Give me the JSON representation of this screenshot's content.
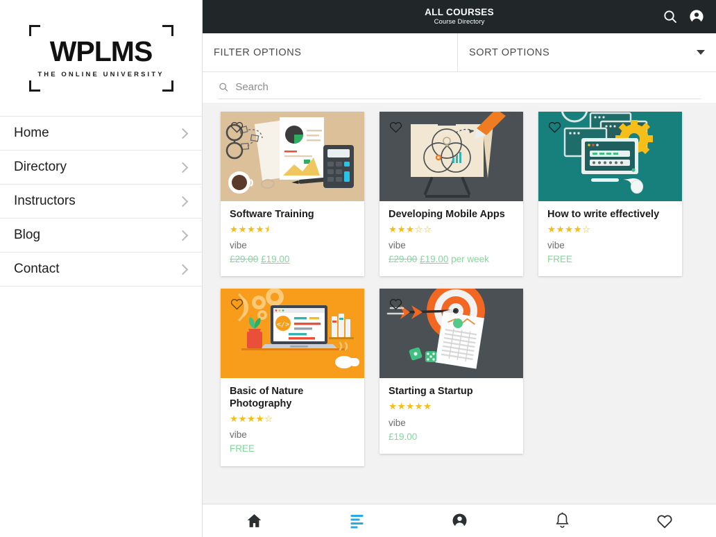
{
  "sidebar": {
    "logo": {
      "word": "WPLMS",
      "tagline": "THE ONLINE UNIVERSITY"
    },
    "items": [
      {
        "label": "Home"
      },
      {
        "label": "Directory"
      },
      {
        "label": "Instructors"
      },
      {
        "label": "Blog"
      },
      {
        "label": "Contact"
      }
    ]
  },
  "header": {
    "title": "ALL COURSES",
    "subtitle": "Course Directory",
    "search_icon": "search-icon",
    "account_icon": "account-circle-icon"
  },
  "filterbar": {
    "filter_label": "FILTER OPTIONS",
    "sort_label": "SORT OPTIONS"
  },
  "search": {
    "placeholder": "Search",
    "value": ""
  },
  "courses": [
    {
      "title": "Software Training",
      "rating": 4.5,
      "stars": "★★★★⯨",
      "author": "vibe",
      "old_price": "£29.00",
      "price": "£19.00",
      "suffix": "",
      "free": false,
      "thumb_bg": "#dcc09a",
      "thumb_art": "desk-flatlay-illustration"
    },
    {
      "title": "Developing Mobile Apps",
      "rating": 3,
      "stars": "★★★☆☆",
      "author": "vibe",
      "old_price": "£29.00",
      "price": "£19.00",
      "suffix": " per week",
      "free": false,
      "thumb_bg": "#4a5053",
      "thumb_art": "easel-venn-diagram-illustration"
    },
    {
      "title": "How to write effectively",
      "rating": 4,
      "stars": "★★★★☆",
      "author": "vibe",
      "old_price": "",
      "price": "FREE",
      "suffix": "",
      "free": true,
      "thumb_bg": "#17807c",
      "thumb_art": "monitors-gear-illustration"
    },
    {
      "title": "Basic of Nature Photography",
      "rating": 4,
      "stars": "★★★★☆",
      "author": "vibe",
      "old_price": "",
      "price": "FREE",
      "suffix": "",
      "free": true,
      "thumb_bg": "#f79c1b",
      "thumb_art": "laptop-coding-illustration"
    },
    {
      "title": "Starting a Startup",
      "rating": 5,
      "stars": "★★★★★",
      "author": "vibe",
      "old_price": "",
      "price": "£19.00",
      "suffix": "",
      "free": false,
      "thumb_bg": "#4a5053",
      "thumb_art": "target-arrow-chart-illustration"
    }
  ],
  "bottom_nav": [
    {
      "icon": "home-icon",
      "active": false
    },
    {
      "icon": "list-directory-icon",
      "active": true
    },
    {
      "icon": "account-circle-icon",
      "active": false
    },
    {
      "icon": "bell-icon",
      "active": false
    },
    {
      "icon": "heart-icon",
      "active": false
    }
  ],
  "colors": {
    "header_bg": "#212628",
    "page_bg": "#f2f2f2",
    "star": "#f5be18",
    "price_green": "#7fd99a",
    "active_blue": "#29abe2"
  }
}
